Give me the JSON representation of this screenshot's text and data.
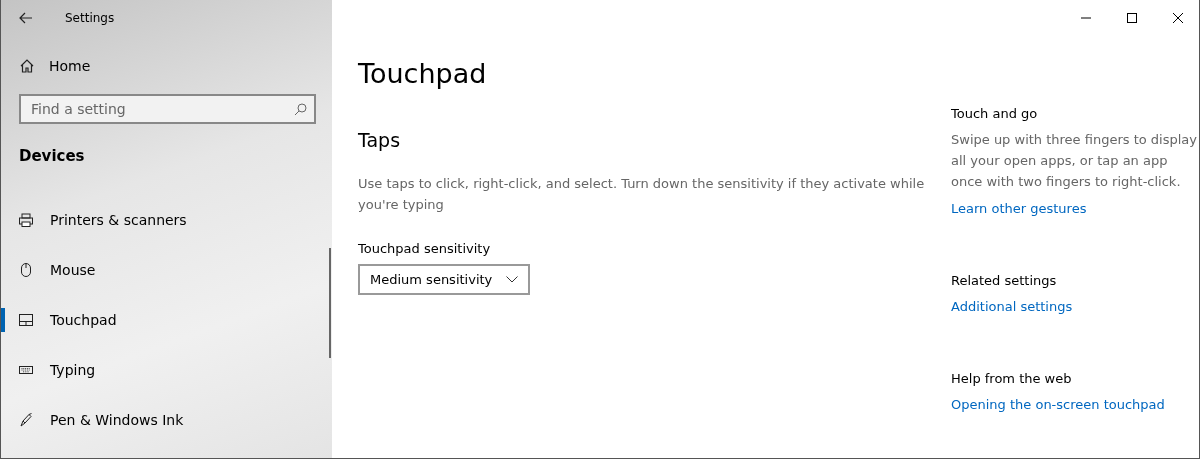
{
  "window": {
    "title": "Settings"
  },
  "sidebar": {
    "home": "Home",
    "search": {
      "placeholder": "Find a setting"
    },
    "section": "Devices",
    "items": [
      {
        "label": "Printers & scanners",
        "kind": "printer",
        "selected": false
      },
      {
        "label": "Mouse",
        "kind": "mouse",
        "selected": false
      },
      {
        "label": "Touchpad",
        "kind": "touchpad",
        "selected": true
      },
      {
        "label": "Typing",
        "kind": "keyboard",
        "selected": false
      },
      {
        "label": "Pen & Windows Ink",
        "kind": "pen",
        "selected": false
      }
    ]
  },
  "main": {
    "title": "Touchpad",
    "section": "Taps",
    "description": "Use taps to click, right-click, and select. Turn down the sensitivity if they activate while you're typing",
    "sensitivity": {
      "label": "Touchpad sensitivity",
      "value": "Medium sensitivity"
    }
  },
  "aside": [
    {
      "heading": "Touch and go",
      "text": "Swipe up with three fingers to display all your open apps, or tap an app once with two fingers to right-click.",
      "link": "Learn other gestures"
    },
    {
      "heading": "Related settings",
      "link": "Additional settings"
    },
    {
      "heading": "Help from the web",
      "link": "Opening the on-screen touchpad"
    }
  ]
}
